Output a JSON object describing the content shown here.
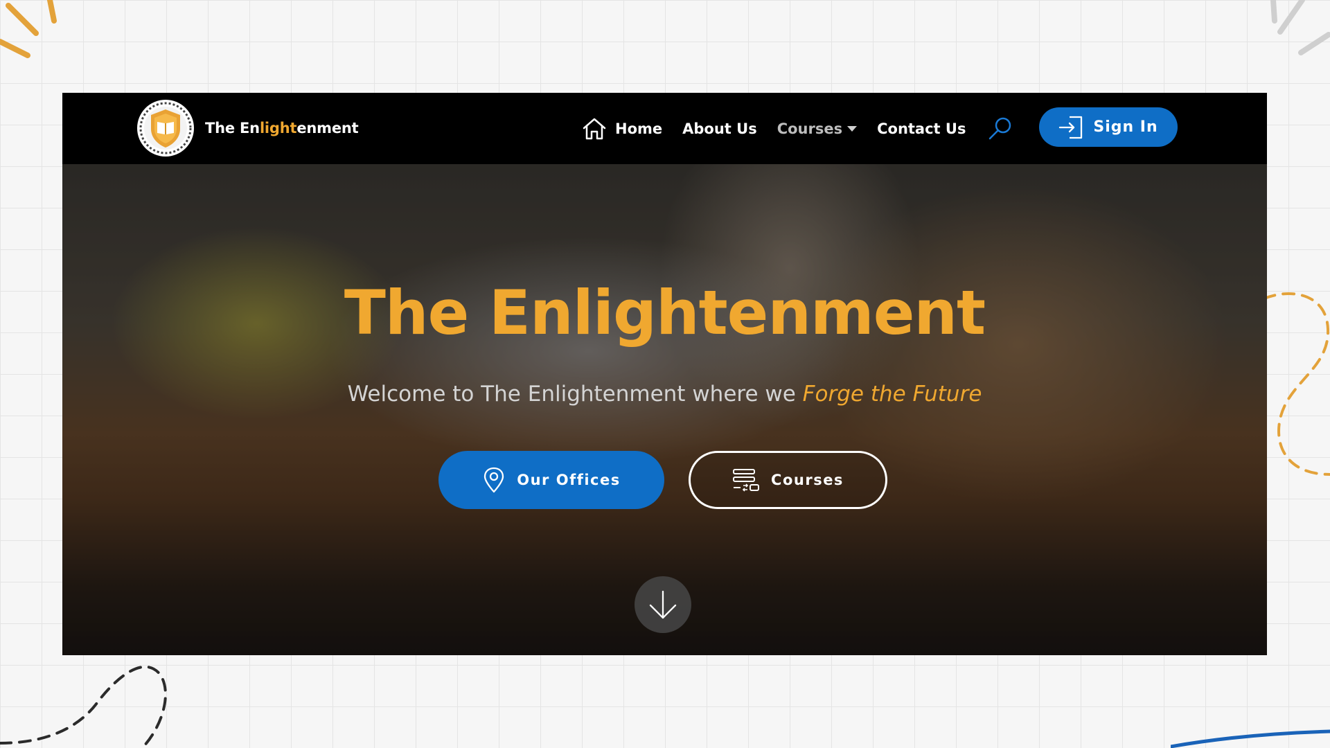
{
  "brand": {
    "name_prefix": "The En",
    "name_highlight": "light",
    "name_suffix": "enment",
    "logo_icon": "shield-book-icon"
  },
  "nav": {
    "items": [
      {
        "label": "Home",
        "icon": "home-icon"
      },
      {
        "label": "About Us"
      },
      {
        "label": "Courses",
        "dropdown": true
      },
      {
        "label": "Contact Us"
      }
    ],
    "search_icon": "search-icon"
  },
  "signin": {
    "label": "Sign In",
    "icon": "sign-in-icon"
  },
  "hero": {
    "title": "The Enlightenment",
    "subtitle_plain": "Welcome to The Enlightenment where we ",
    "subtitle_emphasis": "Forge the Future",
    "buttons": {
      "offices_label": "Our Offices",
      "offices_icon": "map-pin-icon",
      "courses_label": "Courses",
      "courses_icon": "courses-list-icon"
    },
    "scroll_icon": "arrow-down-icon"
  },
  "colors": {
    "accent_orange": "#f0a830",
    "primary_blue": "#0f6ec6",
    "navbar_bg": "#000000"
  }
}
